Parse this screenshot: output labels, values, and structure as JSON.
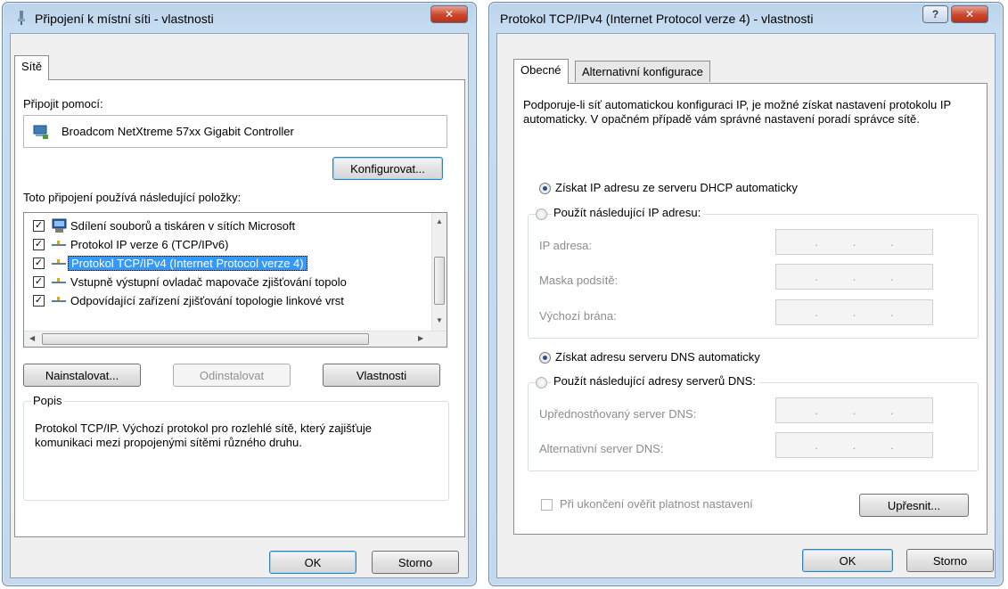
{
  "left_window": {
    "title": "Připojení k místní síti - vlastnosti",
    "close": "✕",
    "tab": "Sítě",
    "connect_using_label": "Připojit pomocí:",
    "adapter": "Broadcom NetXtreme 57xx Gigabit Controller",
    "configure": "Konfigurovat...",
    "items_label": "Toto připojení používá následující položky:",
    "items": [
      {
        "label": "Sdílení souborů a tiskáren v sítích Microsoft",
        "checked": true
      },
      {
        "label": "Protokol IP verze 6 (TCP/IPv6)",
        "checked": true
      },
      {
        "label": "Protokol TCP/IPv4 (Internet Protocol verze 4)",
        "checked": true
      },
      {
        "label": "Vstupně výstupní ovladač mapovače zjišťování topolo",
        "checked": true
      },
      {
        "label": "Odpovídající zařízení zjišťování topologie linkové vrst",
        "checked": true
      }
    ],
    "install": "Nainstalovat...",
    "uninstall": "Odinstalovat",
    "properties": "Vlastnosti",
    "description_label": "Popis",
    "description": "Protokol TCP/IP. Výchozí protokol pro rozlehlé sítě, který zajišťuje komunikaci mezi propojenými sítěmi různého druhu.",
    "ok": "OK",
    "cancel": "Storno"
  },
  "right_window": {
    "title": "Protokol TCP/IPv4 (Internet Protocol verze 4) - vlastnosti",
    "help": "?",
    "close": "✕",
    "tab_general": "Obecné",
    "tab_alternative": "Alternativní konfigurace",
    "intro": "Podporuje-li síť automatickou konfiguraci IP, je možné získat nastavení protokolu IP automaticky. V opačném případě vám správné nastavení poradí správce sítě.",
    "ip_auto": "Získat IP adresu ze serveru DHCP automaticky",
    "ip_manual": "Použít následující IP adresu:",
    "ip_address": "IP adresa:",
    "subnet_mask": "Maska podsítě:",
    "gateway": "Výchozí brána:",
    "dns_auto": "Získat adresu serveru DNS automaticky",
    "dns_manual": "Použít následující adresy serverů DNS:",
    "preferred_dns": "Upřednostňovaný server DNS:",
    "alternate_dns": "Alternativní server DNS:",
    "validate": "Při ukončení ověřit platnost nastavení",
    "advanced": "Upřesnit...",
    "ok": "OK",
    "cancel": "Storno"
  }
}
